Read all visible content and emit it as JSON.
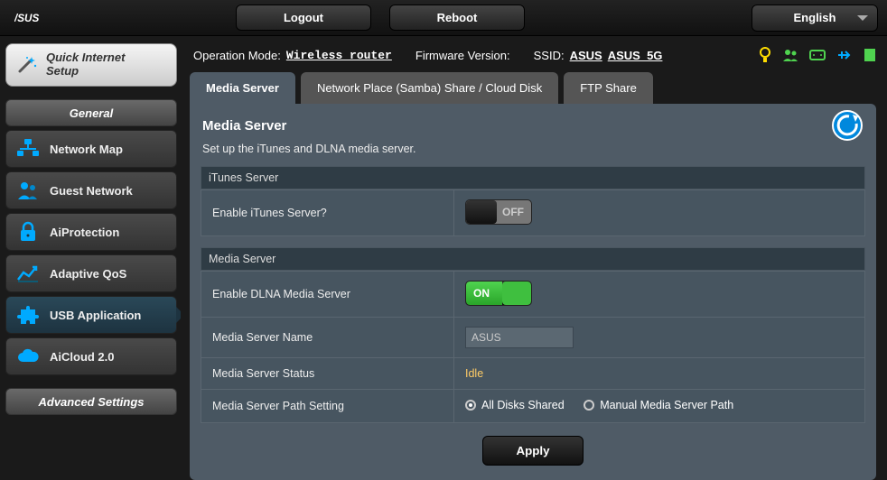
{
  "topbar": {
    "logout": "Logout",
    "reboot": "Reboot",
    "language": "English"
  },
  "info": {
    "op_mode_label": "Operation Mode:",
    "op_mode": "Wireless router",
    "fw_label": "Firmware Version:",
    "ssid_label": "SSID:",
    "ssid1": "ASUS",
    "ssid2": "ASUS_5G"
  },
  "sidebar": {
    "qis1": "Quick Internet",
    "qis2": "Setup",
    "general": "General",
    "items": [
      {
        "label": "Network Map"
      },
      {
        "label": "Guest Network"
      },
      {
        "label": "AiProtection"
      },
      {
        "label": "Adaptive QoS"
      },
      {
        "label": "USB Application"
      },
      {
        "label": "AiCloud 2.0"
      }
    ],
    "advanced": "Advanced Settings"
  },
  "tabs": {
    "media": "Media Server",
    "samba": "Network Place (Samba) Share / Cloud Disk",
    "ftp": "FTP Share"
  },
  "panel": {
    "title": "Media Server",
    "desc": "Set up the iTunes and DLNA media server.",
    "group1": "iTunes Server",
    "row_itunes": "Enable iTunes Server?",
    "off": "OFF",
    "group2": "Media Server",
    "row_dlna": "Enable DLNA Media Server",
    "on": "ON",
    "row_name": "Media Server Name",
    "name_value": "ASUS",
    "row_status": "Media Server Status",
    "status_value": "Idle",
    "row_path": "Media Server Path Setting",
    "radio1": "All Disks Shared",
    "radio2": "Manual Media Server Path",
    "apply": "Apply"
  }
}
